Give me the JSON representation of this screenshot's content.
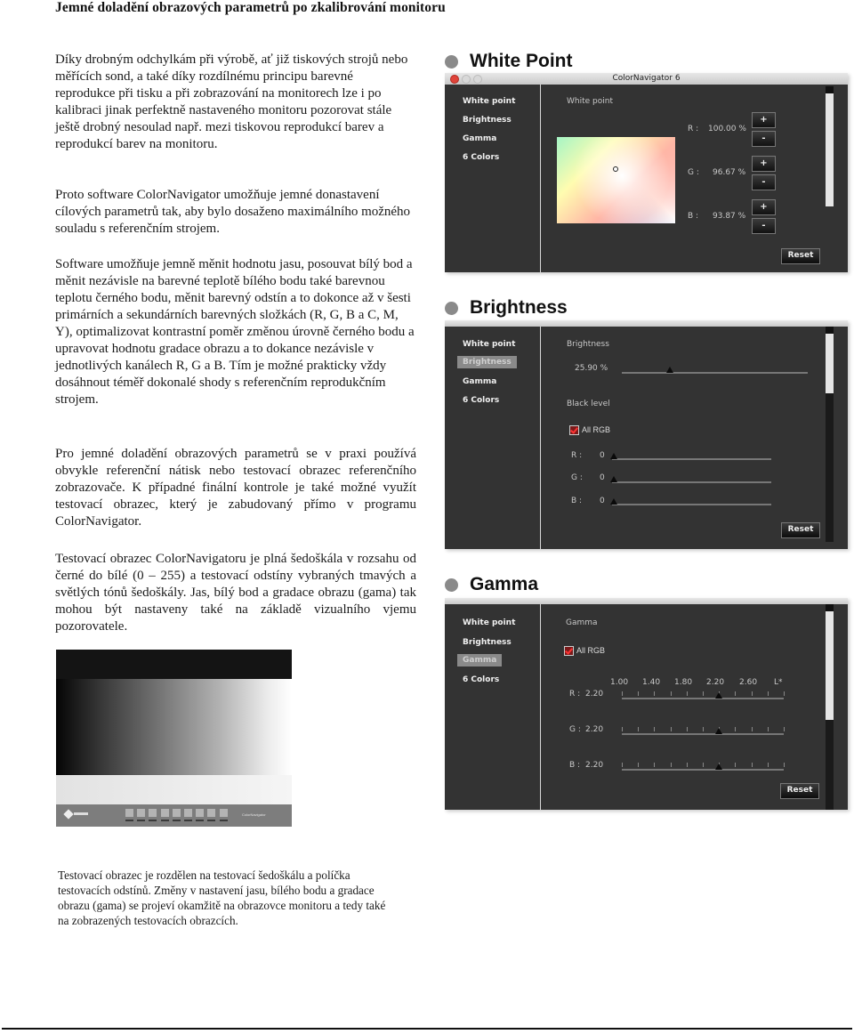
{
  "page": {
    "title": "Jemné doladění obrazových parametrů po zkalibrování monitoru",
    "paragraphs": [
      "Díky drobným odchylkám při výrobě, ať již tiskových strojů nebo měřících sond, a také díky rozdílnému principu barevné reprodukce při tisku a při zobrazování na monitorech lze i po kalibraci jinak perfektně nastaveného monitoru pozorovat stále ještě drobný nesoulad např. mezi tiskovou reprodukcí barev a reprodukcí barev na monitoru.",
      "Proto software ColorNavigator umožňuje jemné donastavení cílových parametrů tak, aby bylo dosaženo maximálního možného souladu s referenčním strojem.",
      "Software umožňuje jemně měnit hodnotu jasu, posouvat bílý bod a měnit nezávisle na barevné teplotě bílého bodu také barevnou teplotu černého bodu, měnit barevný odstín a to dokonce až v šesti primárních a sekundárních barevných složkách (R, G, B a C, M, Y), optimalizovat kontrastní poměr změnou úrovně černého bodu a upravovat hodnotu gradace obrazu a to dokance nezávisle v jednotlivých kanálech R, G a B. Tím je možné prakticky vždy dosáhnout téměř dokonalé shody s referenčním reprodukčním strojem.",
      "Pro jemné doladění obrazových parametrů se v praxi používá obvykle referenční nátisk nebo testovací obrazec referenčního zobrazovače. K případné finální kontrole je také možné využít  testovací obrazec, který je zabudovaný přímo v programu ColorNavigator.",
      "Testovací obrazec ColorNavigatoru je plná šedoškála v rozsahu od černé do bílé (0 – 255) a testovací odstíny vybraných tmavých a světlých tónů šedoškály. Jas, bílý bod  a gradace obrazu (gama) tak mohou být nastaveny také na základě vizualního vjemu pozorovatele."
    ],
    "caption": "Testovací obrazec je rozdělen na testovací šedoškálu a políčka testovacích odstínů. Změny v nastavení jasu, bílého bodu a gradace obrazu (gama) se projeví okamžitě na obrazovce monitoru a tedy také na zobrazených testovacích obrazcích.",
    "test_pattern": {
      "brand": "ColorNavigator",
      "swatch_count": 9
    }
  },
  "app": {
    "window_title": "ColorNavigator 6",
    "sidebar": [
      "White point",
      "Brightness",
      "Gamma",
      "6 Colors"
    ],
    "reset_label": "Reset",
    "plus_label": "+",
    "minus_label": "-"
  },
  "sections": {
    "white_point": {
      "heading": "White Point",
      "panel_label": "White point",
      "active_index": 0,
      "channels": [
        {
          "label": "R :",
          "value": "100.00 %"
        },
        {
          "label": "G :",
          "value": "96.67 %"
        },
        {
          "label": "B :",
          "value": "93.87 %"
        }
      ]
    },
    "brightness": {
      "heading": "Brightness",
      "panel_label": "Brightness",
      "active_index": 1,
      "brightness_value": "25.90 %",
      "brightness_fraction": 0.259,
      "black_level_label": "Black level",
      "all_rgb_label": "All RGB",
      "all_rgb_checked": true,
      "black_channels": [
        {
          "label": "R :",
          "value": "0",
          "fraction": 0
        },
        {
          "label": "G :",
          "value": "0",
          "fraction": 0
        },
        {
          "label": "B :",
          "value": "0",
          "fraction": 0
        }
      ]
    },
    "gamma": {
      "heading": "Gamma",
      "panel_label": "Gamma",
      "active_index": 2,
      "all_rgb_label": "All RGB",
      "all_rgb_checked": true,
      "scale_labels": [
        "1.00",
        "1.40",
        "1.80",
        "2.20",
        "2.60",
        "L*"
      ],
      "channels": [
        {
          "label": "R :",
          "value": "2.20",
          "fraction": 0.6
        },
        {
          "label": "G :",
          "value": "2.20",
          "fraction": 0.6
        },
        {
          "label": "B :",
          "value": "2.20",
          "fraction": 0.6
        }
      ]
    }
  }
}
